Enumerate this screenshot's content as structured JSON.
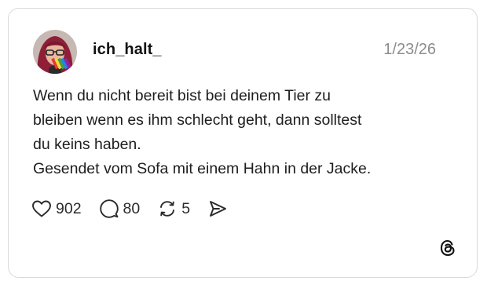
{
  "post": {
    "username": "ich_halt_",
    "date": "1/23/26",
    "lines": [
      "Wenn du nicht bereit bist bei deinem Tier zu",
      "bleiben wenn es ihm schlecht geht, dann solltest",
      "du keins haben.",
      "Gesendet vom Sofa mit einem Hahn in der Jacke."
    ]
  },
  "actions": {
    "likes": "902",
    "replies": "80",
    "reposts": "5"
  },
  "icons": {
    "like": "heart-icon",
    "reply": "comment-icon",
    "repost": "repost-icon",
    "share": "send-icon",
    "brand": "threads-logo-icon"
  },
  "colors": {
    "text": "#1e1e1e",
    "muted": "#8c8c8c",
    "border": "#d9d9d9"
  }
}
